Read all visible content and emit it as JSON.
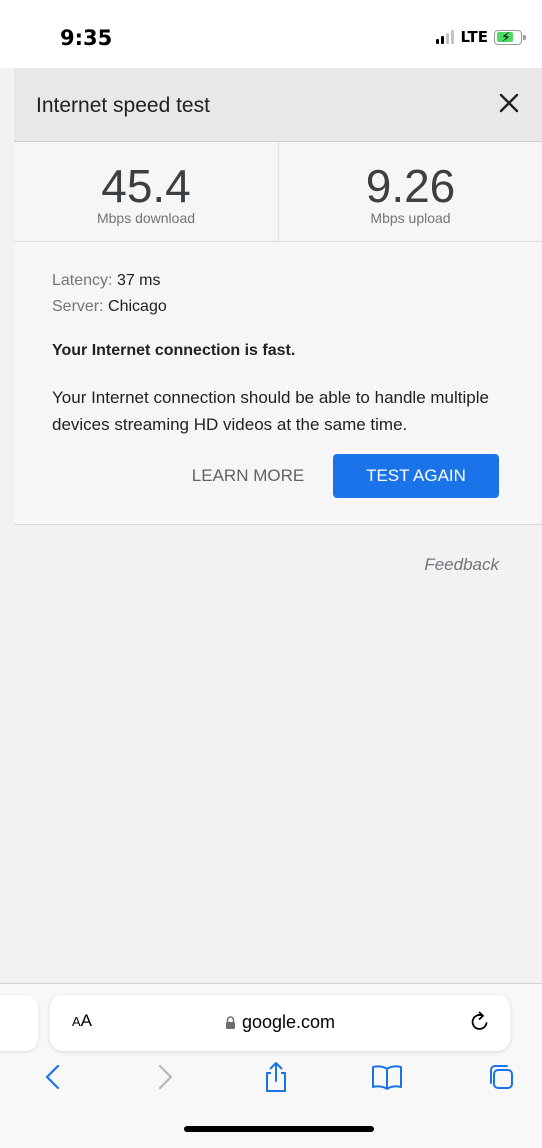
{
  "status": {
    "time": "9:35",
    "network": "LTE"
  },
  "header": {
    "title": "Internet speed test"
  },
  "results": {
    "download": {
      "value": "45.4",
      "label": "Mbps download"
    },
    "upload": {
      "value": "9.26",
      "label": "Mbps upload"
    }
  },
  "details": {
    "latency_label": "Latency:",
    "latency_value": "37 ms",
    "server_label": "Server:",
    "server_value": "Chicago",
    "verdict": "Your Internet connection is fast.",
    "description": "Your Internet connection should be able to handle multiple devices streaming HD videos at the same time."
  },
  "actions": {
    "learn_more": "LEARN MORE",
    "test_again": "TEST AGAIN"
  },
  "feedback": "Feedback",
  "browser": {
    "aa_small": "A",
    "aa_large": "A",
    "url": "google.com"
  },
  "colors": {
    "accent": "#1a73e8",
    "ios_blue": "#1a73e8",
    "battery": "#4cd964"
  }
}
